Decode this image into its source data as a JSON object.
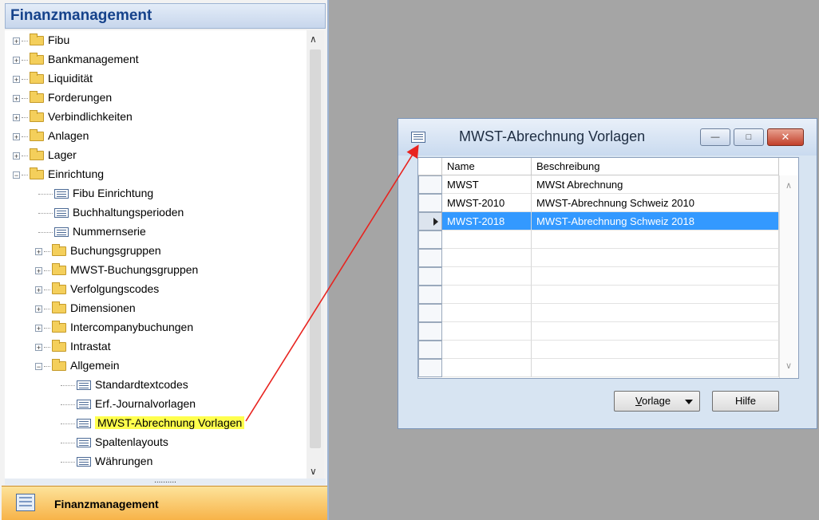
{
  "nav": {
    "header": "Finanzmanagement",
    "tree": [
      {
        "label": "Fibu",
        "type": "folder",
        "expanded": false
      },
      {
        "label": "Bankmanagement",
        "type": "folder",
        "expanded": false
      },
      {
        "label": "Liquidität",
        "type": "folder",
        "expanded": false
      },
      {
        "label": "Forderungen",
        "type": "folder",
        "expanded": false
      },
      {
        "label": "Verbindlichkeiten",
        "type": "folder",
        "expanded": false
      },
      {
        "label": "Anlagen",
        "type": "folder",
        "expanded": false
      },
      {
        "label": "Lager",
        "type": "folder",
        "expanded": false
      },
      {
        "label": "Einrichtung",
        "type": "folder",
        "expanded": true
      },
      {
        "label": "Fibu Einrichtung",
        "type": "form"
      },
      {
        "label": "Buchhaltungsperioden",
        "type": "form"
      },
      {
        "label": "Nummernserie",
        "type": "form"
      },
      {
        "label": "Buchungsgruppen",
        "type": "folder",
        "expanded": false
      },
      {
        "label": "MWST-Buchungsgruppen",
        "type": "folder",
        "expanded": false
      },
      {
        "label": "Verfolgungscodes",
        "type": "folder",
        "expanded": false
      },
      {
        "label": "Dimensionen",
        "type": "folder",
        "expanded": false
      },
      {
        "label": "Intercompanybuchungen",
        "type": "folder",
        "expanded": false
      },
      {
        "label": "Intrastat",
        "type": "folder",
        "expanded": false
      },
      {
        "label": "Allgemein",
        "type": "folder",
        "expanded": true
      },
      {
        "label": "Standardtextcodes",
        "type": "form"
      },
      {
        "label": "Erf.-Journalvorlagen",
        "type": "form"
      },
      {
        "label": "MWST-Abrechnung Vorlagen",
        "type": "form",
        "highlighted": true
      },
      {
        "label": "Spaltenlayouts",
        "type": "form"
      },
      {
        "label": "Währungen",
        "type": "form"
      }
    ],
    "splitter": "..........",
    "bottom_button": "Finanzmanagement"
  },
  "dialog": {
    "title": "MWST-Abrechnung Vorlagen",
    "columns": [
      "Name",
      "Beschreibung"
    ],
    "rows": [
      {
        "name": "MWST",
        "description": "MWSt Abrechnung"
      },
      {
        "name": "MWST-2010",
        "description": "MWST-Abrechnung Schweiz 2010"
      },
      {
        "name": "MWST-2018",
        "description": "MWST-Abrechnung Schweiz 2018",
        "selected": true
      }
    ],
    "vorlage_button": {
      "accel": "V",
      "rest": "orlage"
    },
    "hilfe_button": "Hilfe"
  },
  "colors": {
    "highlight": "#ffff4d",
    "selection": "#3399ff",
    "annotation_arrow": "#e8231f",
    "header_text": "#15428b"
  }
}
